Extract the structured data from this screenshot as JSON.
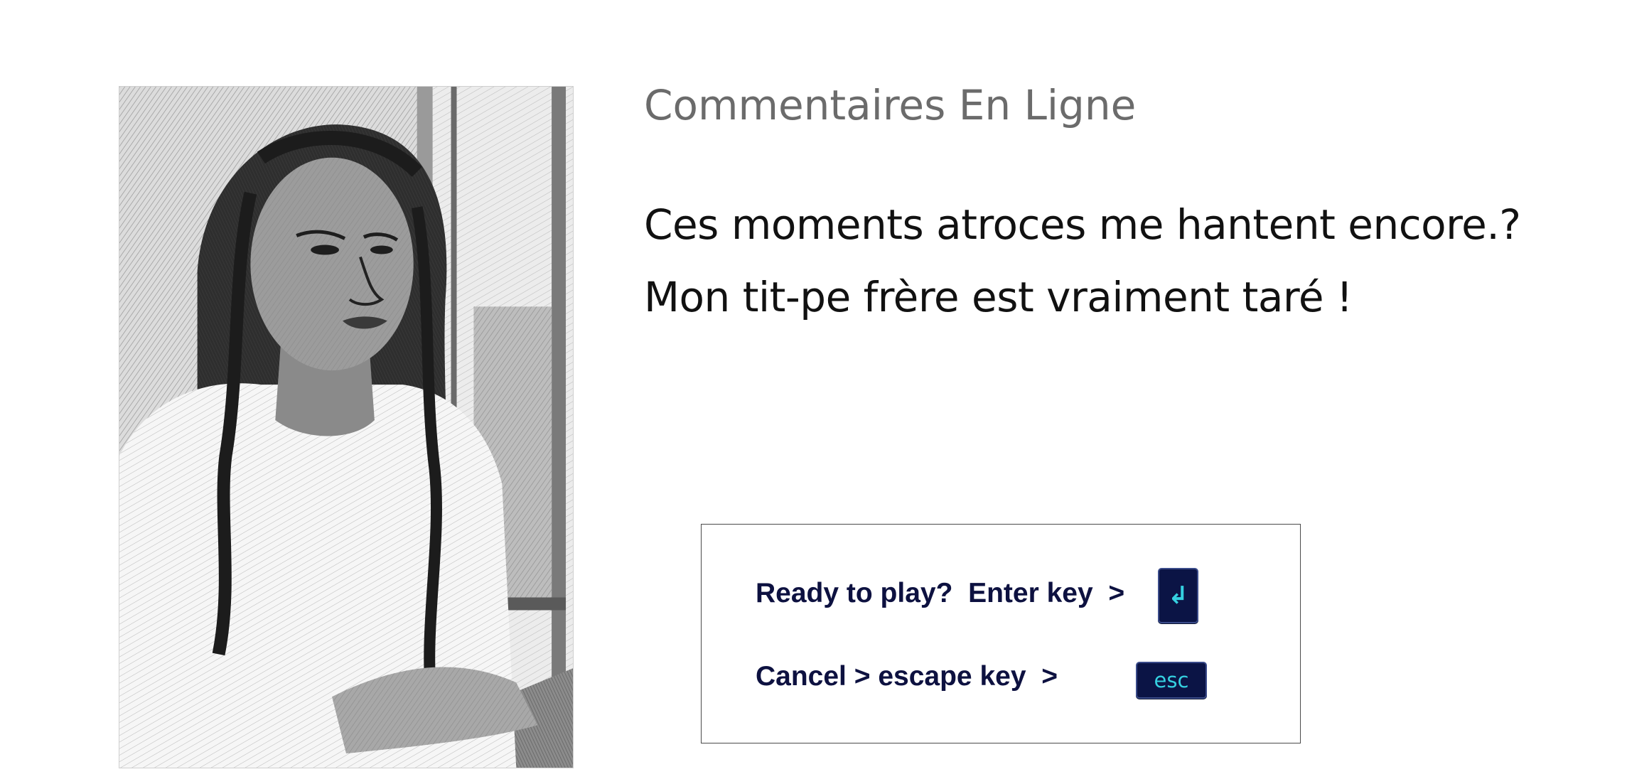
{
  "illustration": {
    "icon": "portrait-sketch",
    "palette": {
      "ink": "#2b2b2b",
      "paper": "#f2f2f2"
    }
  },
  "content": {
    "title": "Commentaires En Ligne",
    "lines": [
      "Ces moments atroces me hantent encore.?",
      "Mon tit-pe frère est vraiment taré !"
    ]
  },
  "prompt": {
    "ready_label": "Ready to play?  Enter key  >",
    "enter_key_glyph": "↲",
    "cancel_label": "Cancel > escape key  >",
    "esc_key_label": "esc"
  },
  "colors": {
    "title": "#6b6b6b",
    "text": "#111111",
    "prompt_text": "#0d1140",
    "key_bg": "#0b1445",
    "key_fg": "#35d0e0"
  }
}
